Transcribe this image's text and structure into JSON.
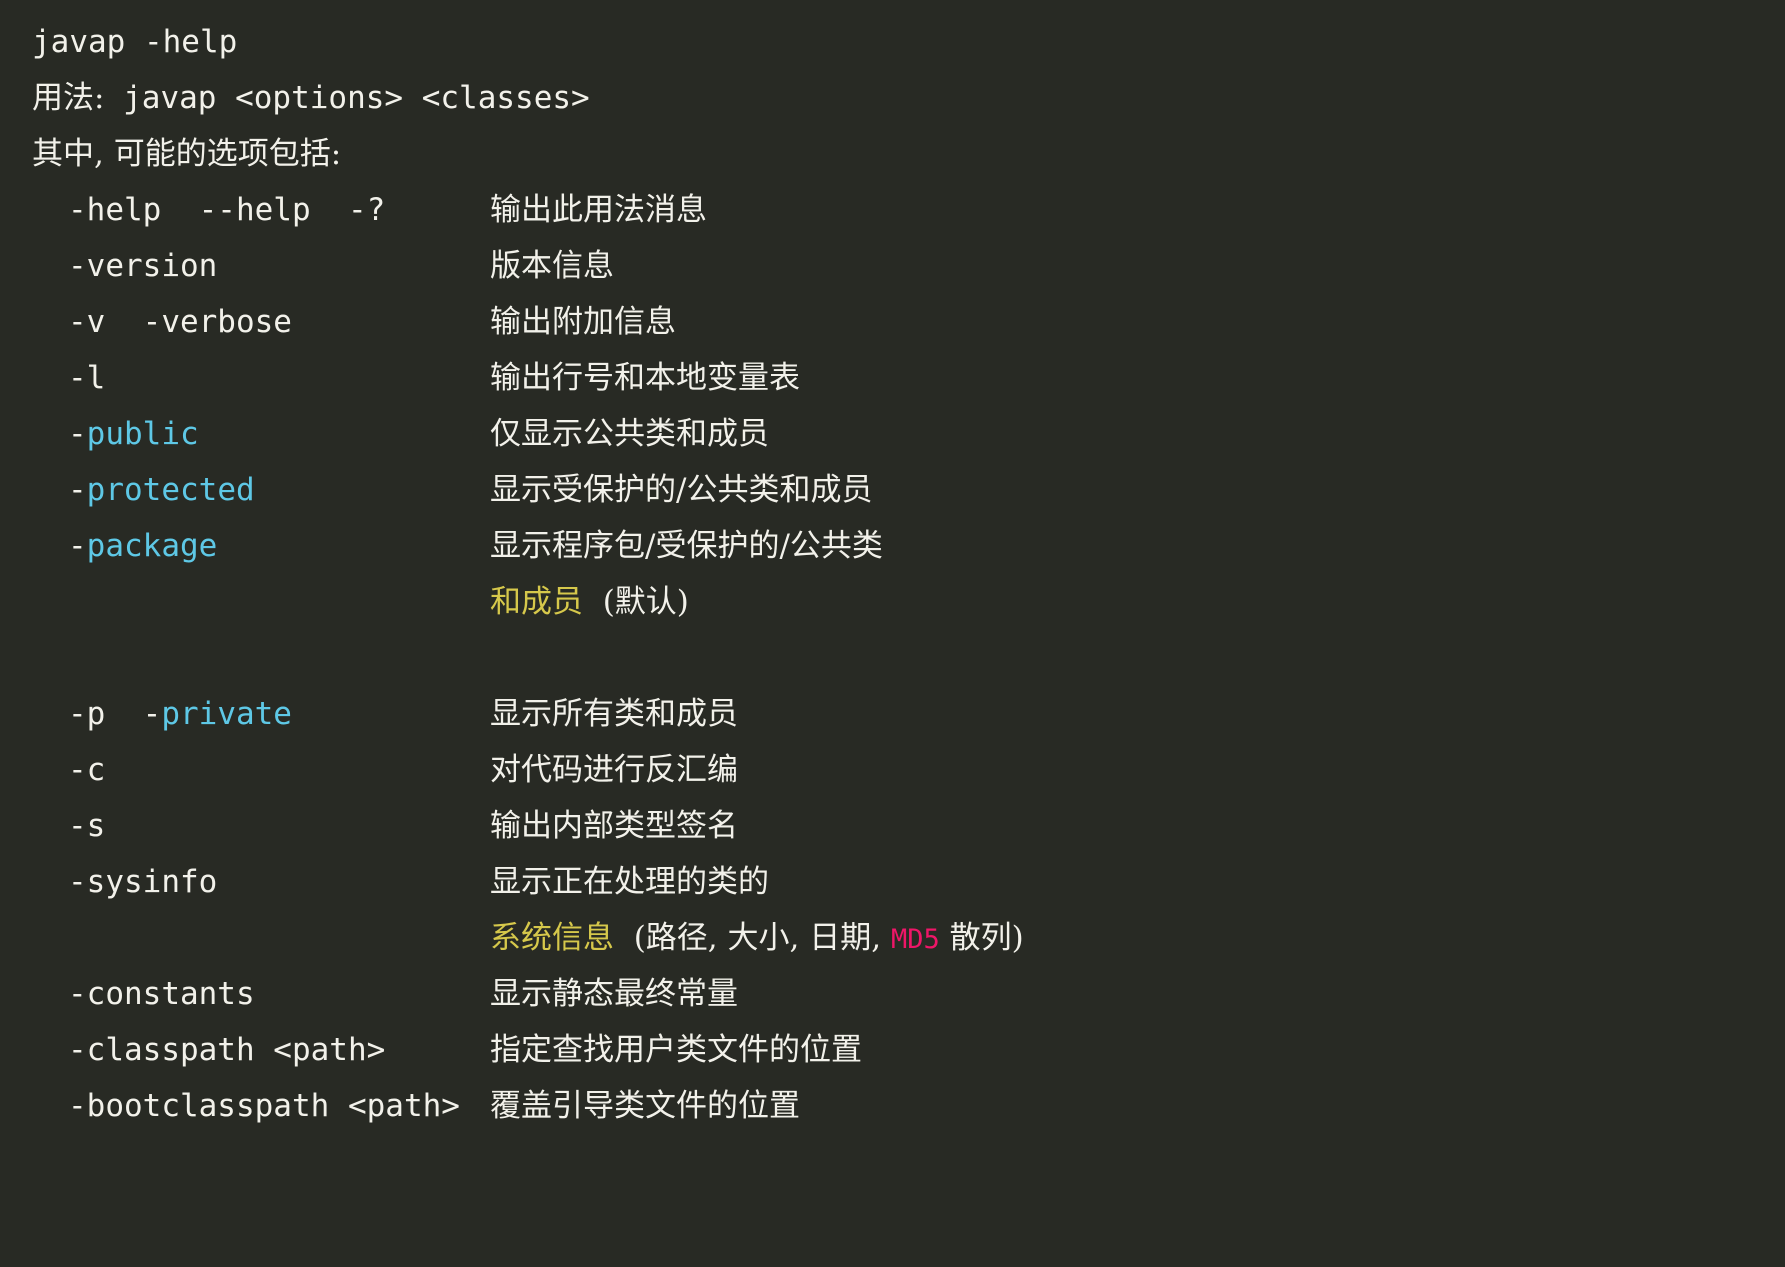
{
  "terminal": {
    "background_color": "#282a24",
    "foreground_color": "#f2f1ea",
    "keyword_color": "#5ec8e6",
    "highlight_color": "#d6c84b",
    "accent_color": "#ef1668",
    "command": "javap -help",
    "usage_label": "用法:",
    "usage_value": " javap <options> <classes>",
    "options_intro": "其中, 可能的选项包括:"
  },
  "options": [
    {
      "flag_plain": "-help  --help  -?",
      "flag_dash": "",
      "flag_keyword": "",
      "description": "输出此用法消息",
      "keyword_styled": false
    },
    {
      "flag_plain": "-version",
      "description": "版本信息",
      "keyword_styled": false
    },
    {
      "flag_plain": "-v  -verbose",
      "description": "输出附加信息",
      "keyword_styled": false
    },
    {
      "flag_plain": "-l",
      "description": "输出行号和本地变量表",
      "keyword_styled": false
    },
    {
      "flag_dash": "-",
      "flag_keyword": "public",
      "description": "仅显示公共类和成员",
      "keyword_styled": true
    },
    {
      "flag_dash": "-",
      "flag_keyword": "protected",
      "description": "显示受保护的/公共类和成员",
      "keyword_styled": true
    },
    {
      "flag_dash": "-",
      "flag_keyword": "package",
      "description": "显示程序包/受保护的/公共类",
      "keyword_styled": true,
      "continuation": {
        "highlight": "和成员",
        "rest": "  (默认)"
      }
    },
    {
      "flag_plain_prefix": "-p  ",
      "flag_dash": "-",
      "flag_keyword": "private",
      "description": "显示所有类和成员",
      "keyword_styled": true
    },
    {
      "flag_plain": "-c",
      "description": "对代码进行反汇编",
      "keyword_styled": false
    },
    {
      "flag_plain": "-s",
      "description": "输出内部类型签名",
      "keyword_styled": false
    },
    {
      "flag_plain": "-sysinfo",
      "description": "显示正在处理的类的",
      "keyword_styled": false,
      "continuation": {
        "highlight": "系统信息",
        "rest_before": "  (路径, 大小, 日期, ",
        "accent": "MD5",
        "rest_after": " 散列)"
      }
    },
    {
      "flag_plain": "-constants",
      "description": "显示静态最终常量",
      "keyword_styled": false
    },
    {
      "flag_plain": "-classpath <path>",
      "description": "指定查找用户类文件的位置",
      "keyword_styled": false
    },
    {
      "flag_plain": "-bootclasspath <path>",
      "description": "覆盖引导类文件的位置",
      "keyword_styled": false
    }
  ]
}
